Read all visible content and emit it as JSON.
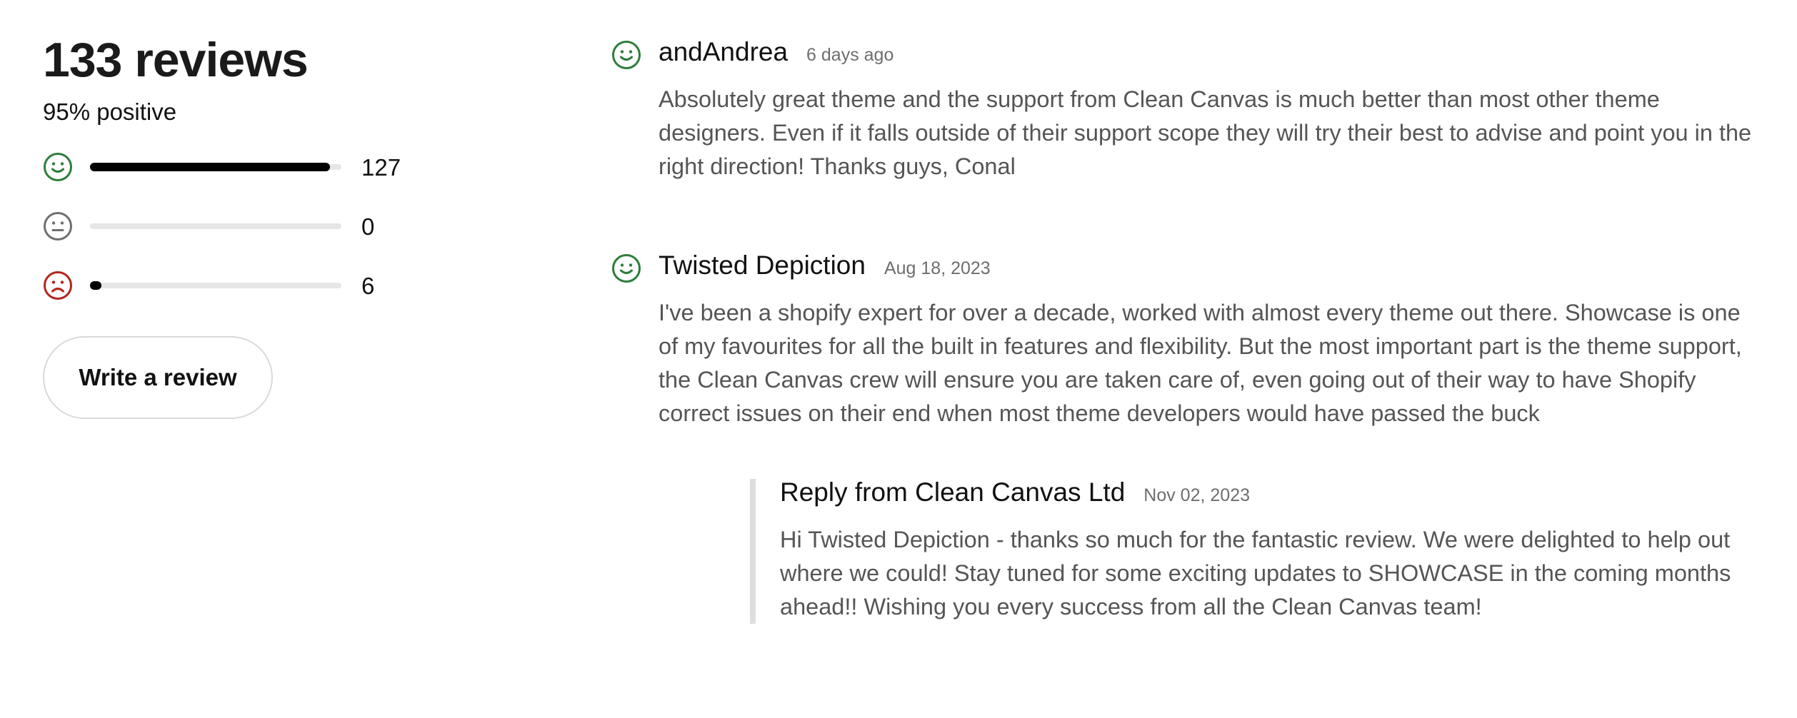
{
  "summary": {
    "title": "133 reviews",
    "positive_text": "95% positive",
    "distribution": [
      {
        "sentiment": "positive",
        "icon": "smiley-happy-icon",
        "color": "#2e7d3c",
        "count": "127",
        "fraction": 0.955
      },
      {
        "sentiment": "neutral",
        "icon": "smiley-neutral-icon",
        "color": "#6f6f6f",
        "count": "0",
        "fraction": 0.0
      },
      {
        "sentiment": "negative",
        "icon": "smiley-sad-icon",
        "color": "#b3261e",
        "count": "6",
        "fraction": 0.045
      }
    ],
    "write_review_label": "Write a review"
  },
  "reviews": [
    {
      "author": "andAndrea",
      "date": "6 days ago",
      "sentiment_icon": "smiley-happy-icon",
      "body": "Absolutely great theme and the support from Clean Canvas is much better than most other theme designers. Even if it falls outside of their support scope they will try their best to advise and point you in the right direction! Thanks guys, Conal"
    },
    {
      "author": "Twisted Depiction",
      "date": "Aug 18, 2023",
      "sentiment_icon": "smiley-happy-icon",
      "body": "I've been a shopify expert for over a decade, worked with almost every theme out there. Showcase is one of my favourites for all the built in features and flexibility. But the most important part is the theme support, the Clean Canvas crew will ensure you are taken care of, even going out of their way to have Shopify correct issues on their end when most theme developers would have passed the buck",
      "reply": {
        "author": "Reply from Clean Canvas Ltd",
        "date": "Nov 02, 2023",
        "body": "Hi Twisted Depiction - thanks so much for the fantastic review. We were delighted to help out where we could! Stay tuned for some exciting updates to SHOWCASE in the coming months ahead!! Wishing you every success from all the Clean Canvas team!"
      }
    }
  ],
  "colors": {
    "positive": "#2e7d3c",
    "neutral": "#6f6f6f",
    "negative": "#b3261e"
  }
}
